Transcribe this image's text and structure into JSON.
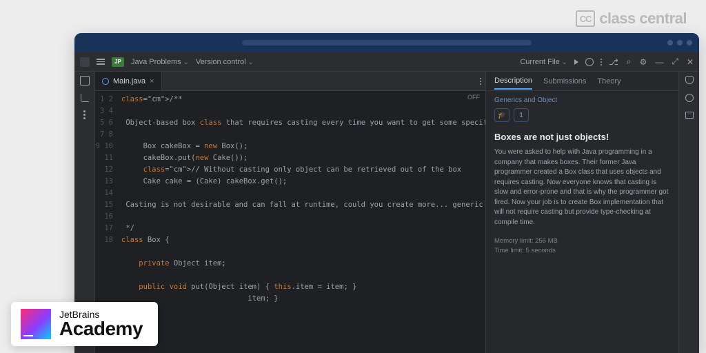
{
  "brand": {
    "cc_text": "class central",
    "cc_abbr": "CC"
  },
  "topbar": {
    "project_badge": "JP",
    "project_name": "Java Problems",
    "vcs": "Version control",
    "run_config": "Current File"
  },
  "tabs": {
    "file": "Main.java"
  },
  "editor": {
    "off": "OFF",
    "lines": [
      "1",
      "2",
      "3",
      "4",
      "5",
      "6",
      "7",
      "8",
      "9",
      "10",
      "11",
      "12",
      "13",
      "14",
      "15",
      "16",
      "17",
      "18"
    ],
    "code": [
      "/**",
      "",
      " Object-based box class that requires casting every time you want to get some specific stuff from it, e.g",
      "",
      "     Box cakeBox = new Box();",
      "     cakeBox.put(new Cake());",
      "     // Without casting only object can be retrieved out of the box",
      "     Cake cake = (Cake) cakeBox.get();",
      "",
      " Casting is not desirable and can fall at runtime, could you create more... generic solution?",
      "",
      " */",
      "class Box {",
      "",
      "    private Object item;",
      "",
      "    public void put(Object item) { this.item = item; }",
      "                             item; }"
    ]
  },
  "right": {
    "tabs": {
      "desc": "Description",
      "subs": "Submissions",
      "theory": "Theory"
    },
    "breadcrumb": "Generics and Object",
    "pill_value": "1",
    "title": "Boxes are not just objects!",
    "body": "You were asked to help with Java programming in a company that makes boxes. Their former Java programmer created a Box class that uses objects and requires casting. Now everyone knows that casting is slow and error-prone and that is why the programmer got fired. Now your job is to create Box implementation that will not require casting but provide type-checking at compile time.",
    "mem": "Memory limit: 256 MB",
    "time": "Time limit: 5 seconds"
  },
  "jb_badge": {
    "line1": "JetBrains",
    "line2": "Academy"
  }
}
